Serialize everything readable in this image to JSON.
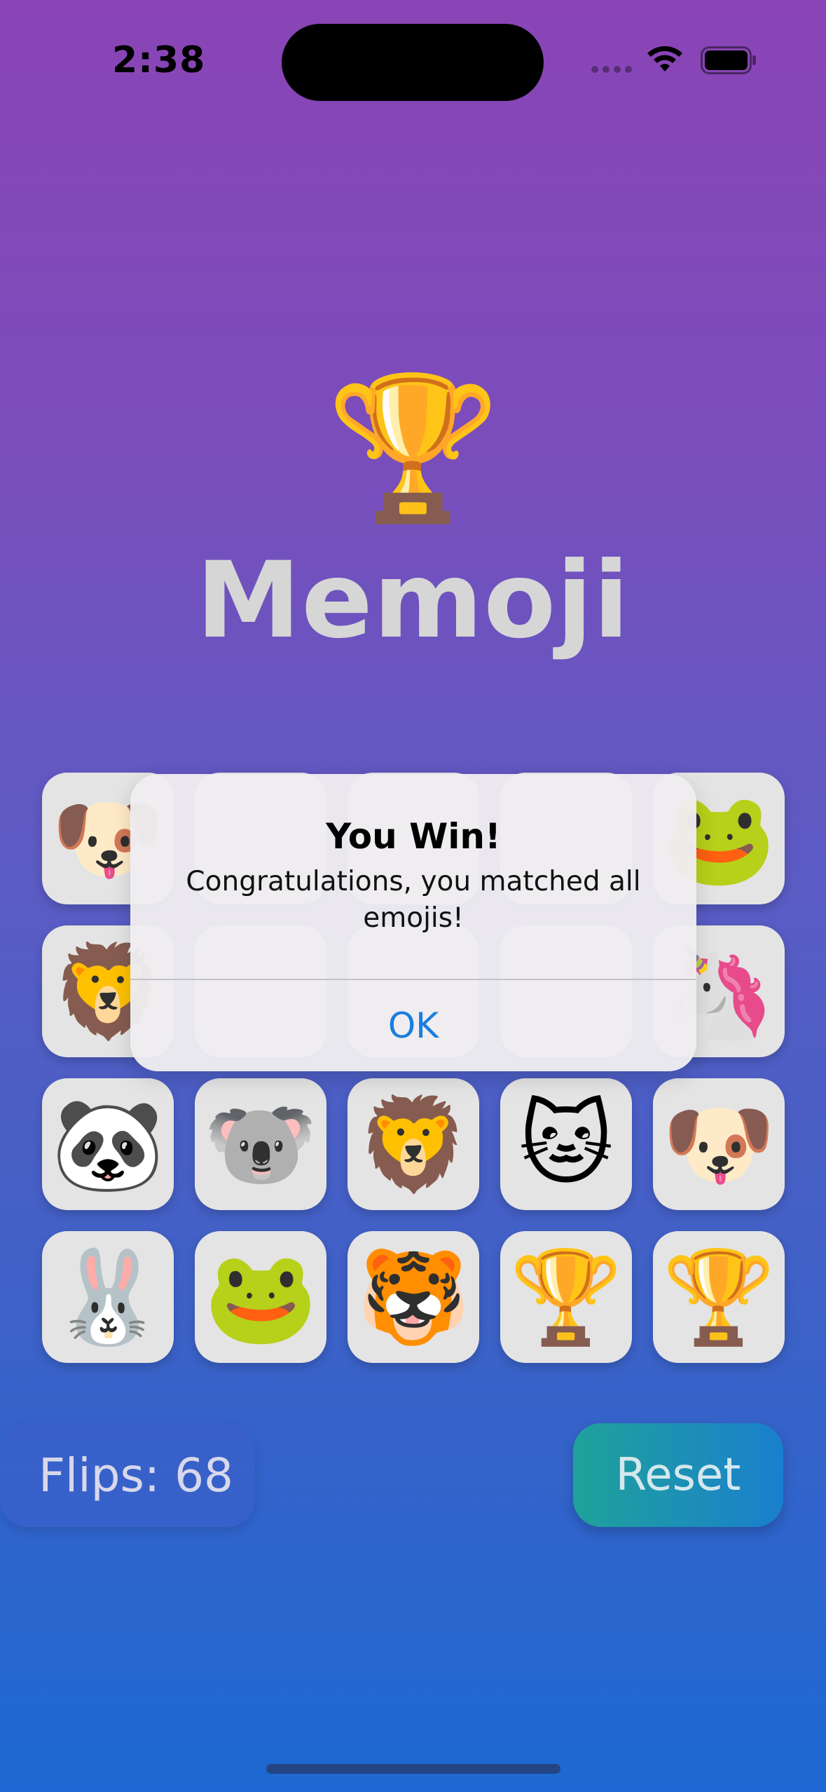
{
  "status_bar": {
    "time": "2:38",
    "icons": [
      "signal-dots-icon",
      "wifi-icon",
      "battery-icon"
    ]
  },
  "header": {
    "trophy_emoji": "🏆",
    "title": "Memoji"
  },
  "grid": {
    "cards": [
      {
        "emoji": "🐶",
        "icon": "dog-icon"
      },
      {
        "emoji": "",
        "icon": "hidden-card"
      },
      {
        "emoji": "",
        "icon": "hidden-card"
      },
      {
        "emoji": "",
        "icon": "hidden-card"
      },
      {
        "emoji": "🐸",
        "icon": "frog-icon"
      },
      {
        "emoji": "🦁",
        "icon": "lion-icon"
      },
      {
        "emoji": "",
        "icon": "hidden-card"
      },
      {
        "emoji": "",
        "icon": "hidden-card"
      },
      {
        "emoji": "",
        "icon": "hidden-card"
      },
      {
        "emoji": "🦄",
        "icon": "unicorn-icon"
      },
      {
        "emoji": "🐼",
        "icon": "panda-icon"
      },
      {
        "emoji": "🐨",
        "icon": "koala-icon"
      },
      {
        "emoji": "🦁",
        "icon": "lion-icon"
      },
      {
        "emoji": "🐱",
        "icon": "cat-icon"
      },
      {
        "emoji": "🐶",
        "icon": "dog-icon"
      },
      {
        "emoji": "🐰",
        "icon": "rabbit-icon"
      },
      {
        "emoji": "🐸",
        "icon": "frog-icon"
      },
      {
        "emoji": "🐯",
        "icon": "tiger-icon"
      },
      {
        "emoji": "🏆",
        "icon": "trophy-icon"
      },
      {
        "emoji": "🏆",
        "icon": "trophy-icon"
      }
    ]
  },
  "controls": {
    "flips_label": "Flips: 68",
    "reset_label": "Reset"
  },
  "alert": {
    "title": "You Win!",
    "message": "Congratulations, you matched all emojis!",
    "ok_label": "OK"
  },
  "colors": {
    "background_top": "#8a44b6",
    "background_bottom": "#1d68d2",
    "card": "#e4e4e4",
    "alert_button": "#1a7ee0",
    "reset_gradient_start": "#1fa29a",
    "reset_gradient_end": "#1a7fce"
  }
}
